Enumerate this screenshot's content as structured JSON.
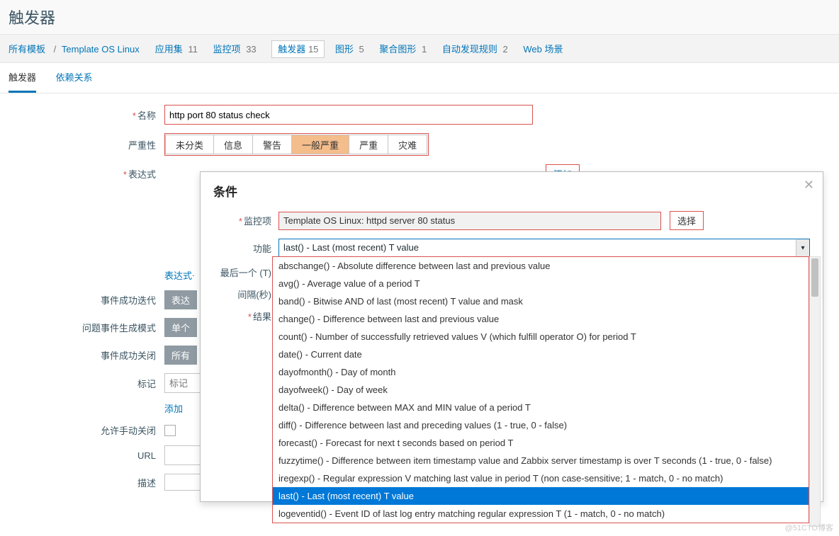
{
  "page_title": "触发器",
  "breadcrumb": {
    "root": "所有模板",
    "template": "Template OS Linux",
    "items": [
      {
        "label": "应用集",
        "count": "11"
      },
      {
        "label": "监控项",
        "count": "33"
      },
      {
        "label": "触发器",
        "count": "15"
      },
      {
        "label": "图形",
        "count": "5"
      },
      {
        "label": "聚合图形",
        "count": "1"
      },
      {
        "label": "自动发现规则",
        "count": "2"
      },
      {
        "label": "Web 场景",
        "count": ""
      }
    ]
  },
  "sub_tabs": {
    "active": "触发器",
    "other": "依赖关系"
  },
  "form": {
    "name_label": "名称",
    "name_value": "http port 80 status check",
    "severity_label": "严重性",
    "severity_options": [
      "未分类",
      "信息",
      "警告",
      "一般严重",
      "严重",
      "灾难"
    ],
    "severity_selected": "一般严重",
    "expr_label": "表达式",
    "add_btn": "添加",
    "expr_constructor": "表达式ᐧ",
    "ok_event_label": "事件成功迭代",
    "ok_event_btn": "表达",
    "problem_mode_label": "问题事件生成模式",
    "problem_mode_btn": "单个",
    "ok_close_label": "事件成功关闭",
    "ok_close_btn": "所有",
    "tags_label": "标记",
    "tag_placeholder": "标记",
    "tag_add": "添加",
    "manual_close_label": "允许手动关闭",
    "url_label": "URL",
    "desc_label": "描述"
  },
  "modal": {
    "title": "条件",
    "item_label": "监控项",
    "item_value": "Template OS Linux: httpd server 80 status",
    "select_btn": "选择",
    "func_label": "功能",
    "func_selected": "last() - Last (most recent) T value",
    "last_t_label": "最后一个 (T)",
    "interval_label": "间隔(秒)",
    "result_label": "结果",
    "options": [
      "abschange() - Absolute difference between last and previous value",
      "avg() - Average value of a period T",
      "band() - Bitwise AND of last (most recent) T value and mask",
      "change() - Difference between last and previous value",
      "count() - Number of successfully retrieved values V (which fulfill operator O) for period T",
      "date() - Current date",
      "dayofmonth() - Day of month",
      "dayofweek() - Day of week",
      "delta() - Difference between MAX and MIN value of a period T",
      "diff() - Difference between last and preceding values (1 - true, 0 - false)",
      "forecast() - Forecast for next t seconds based on period T",
      "fuzzytime() - Difference between item timestamp value and Zabbix server timestamp is over T seconds (1 - true, 0 - false)",
      "iregexp() - Regular expression V matching last value in period T (non case-sensitive; 1 - match, 0 - no match)",
      "last() - Last (most recent) T value",
      "logeventid() - Event ID of last log entry matching regular expression T (1 - match, 0 - no match)"
    ]
  },
  "watermark": "@51CTO博客"
}
